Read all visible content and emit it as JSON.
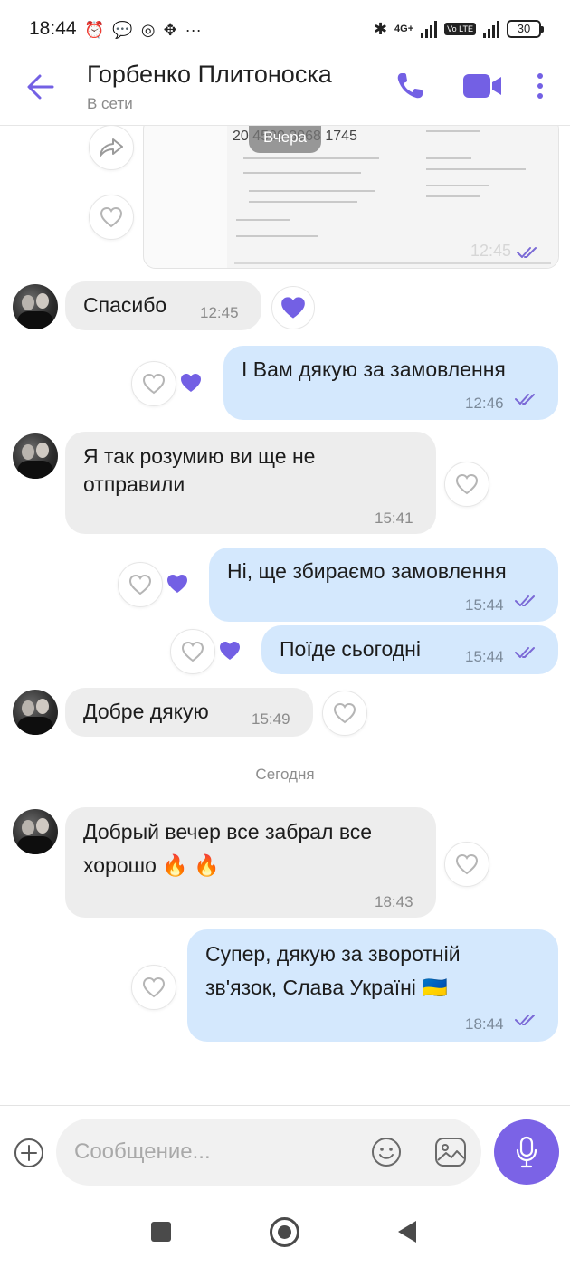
{
  "status_bar": {
    "time": "18:44",
    "network_label": "4G+",
    "volte_label": "Vo LTE",
    "battery": "30"
  },
  "header": {
    "contact_name": "Горбенко Плитоноска",
    "contact_status": "В сети"
  },
  "colors": {
    "accent": "#7b63e6",
    "outgoing_bubble": "#d4e8fd",
    "incoming_bubble": "#ededed"
  },
  "image_message": {
    "date_chip": "Вчера",
    "tracking_number": "20 4500 3068 1745",
    "time": "12:45"
  },
  "messages": [
    {
      "id": "m1",
      "direction": "in",
      "lines": [
        "Спасибо"
      ],
      "time": "12:45",
      "reaction": "liked"
    },
    {
      "id": "m2",
      "direction": "out",
      "lines": [
        "І Вам дякую за замовлення"
      ],
      "time": "12:46",
      "reaction": "liked"
    },
    {
      "id": "m3",
      "direction": "in",
      "lines": [
        "Я так розумию ви ще не",
        "отправили"
      ],
      "time": "15:41",
      "reaction": "none"
    },
    {
      "id": "m4",
      "direction": "out",
      "lines": [
        "Ні, ще збираємо замовлення"
      ],
      "time": "15:44",
      "reaction": "liked"
    },
    {
      "id": "m5",
      "direction": "out",
      "lines": [
        "Поїде сьогодні"
      ],
      "time": "15:44",
      "reaction": "liked"
    },
    {
      "id": "m6",
      "direction": "in",
      "lines": [
        "Добре дякую"
      ],
      "time": "15:49",
      "reaction": "none"
    },
    {
      "id": "m7",
      "direction": "in",
      "lines": [
        "Добрый вечер все забрал все",
        "хорошо 🔥 🔥"
      ],
      "time": "18:43",
      "reaction": "none"
    },
    {
      "id": "m8",
      "direction": "out",
      "lines": [
        "Супер, дякую за зворотній",
        "зв'язок, Слава Україні 🇺🇦"
      ],
      "time": "18:44",
      "reaction": "none"
    }
  ],
  "day_separator": "Сегодня",
  "composer": {
    "placeholder": "Сообщение..."
  },
  "icons": [
    "back-arrow-icon",
    "phone-icon",
    "video-camera-icon",
    "more-vert-icon",
    "share-icon",
    "heart-outline-icon",
    "heart-filled-icon",
    "double-check-icon",
    "add-circle-icon",
    "emoji-icon",
    "gallery-icon",
    "microphone-icon"
  ]
}
